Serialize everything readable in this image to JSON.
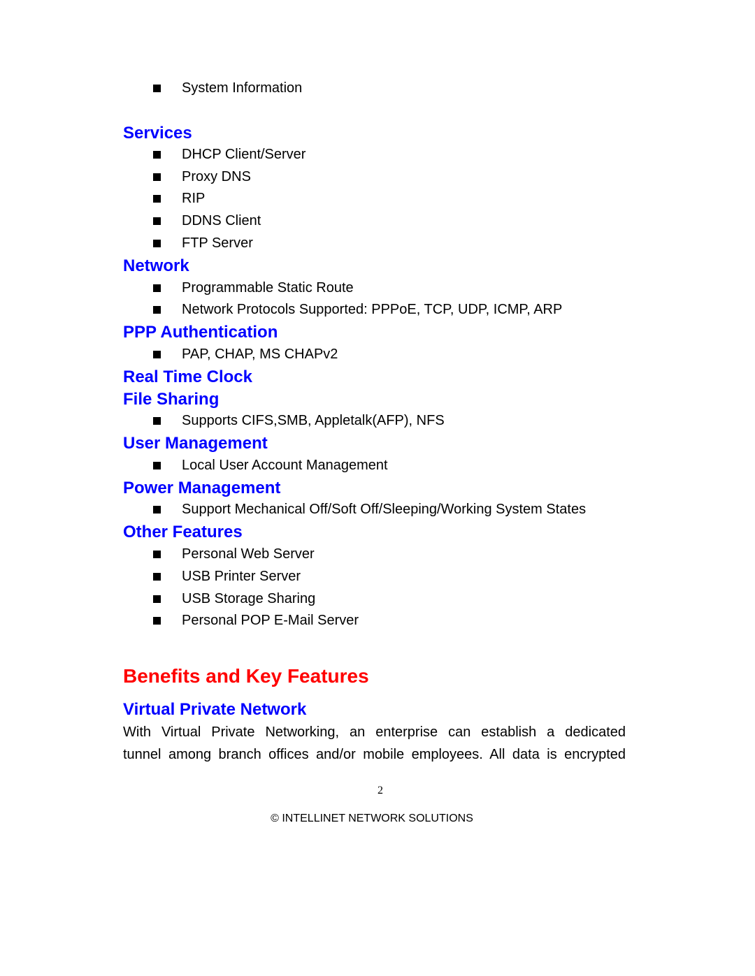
{
  "sections": [
    {
      "items": [
        "System Information"
      ]
    },
    {
      "heading": "Services",
      "items": [
        "DHCP Client/Server",
        "Proxy DNS",
        "RIP",
        "DDNS Client",
        "FTP Server"
      ]
    },
    {
      "heading": "Network",
      "items": [
        "Programmable Static Route",
        "Network Protocols Supported: PPPoE, TCP, UDP, ICMP, ARP"
      ]
    },
    {
      "heading": "PPP Authentication",
      "items": [
        "PAP, CHAP, MS CHAPv2"
      ]
    },
    {
      "heading": "Real Time Clock",
      "items": []
    },
    {
      "heading": "File Sharing",
      "items": [
        "Supports CIFS,SMB, Appletalk(AFP), NFS"
      ]
    },
    {
      "heading": "User Management",
      "items": [
        "Local User Account Management"
      ]
    },
    {
      "heading": "Power Management",
      "items": [
        "Support Mechanical Off/Soft Off/Sleeping/Working System States"
      ]
    },
    {
      "heading": "Other Features",
      "items": [
        "Personal Web Server",
        "USB Printer Server",
        "USB Storage Sharing",
        "Personal POP E-Mail Server"
      ]
    }
  ],
  "benefits": {
    "title": "Benefits and Key Features",
    "subheading": "Virtual Private Network",
    "paragraph_lines": [
      "With Virtual Private Networking, an enterprise can establish a dedicated",
      "tunnel among branch offices and/or mobile employees. All data is encrypted"
    ]
  },
  "page_number": "2",
  "footer": "© INTELLINET NETWORK SOLUTIONS",
  "colors": {
    "heading": "#0000ff",
    "title": "#ff0000"
  }
}
